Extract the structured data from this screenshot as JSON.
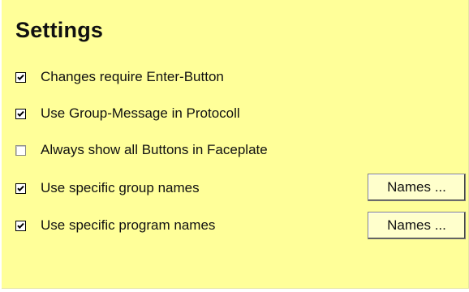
{
  "panel": {
    "title": "Settings"
  },
  "settings": [
    {
      "label": "Changes require Enter-Button",
      "checked": true
    },
    {
      "label": "Use Group-Message in Protocoll",
      "checked": true
    },
    {
      "label": "Always show all Buttons in Faceplate",
      "checked": false
    },
    {
      "label": "Use specific group names",
      "checked": true,
      "button": "Names ..."
    },
    {
      "label": "Use specific program names",
      "checked": true,
      "button": "Names ..."
    }
  ],
  "colors": {
    "panel_background": "#ffff99",
    "button_background": "#ffffcc"
  },
  "icons": {
    "checked": "check-mark-icon"
  }
}
